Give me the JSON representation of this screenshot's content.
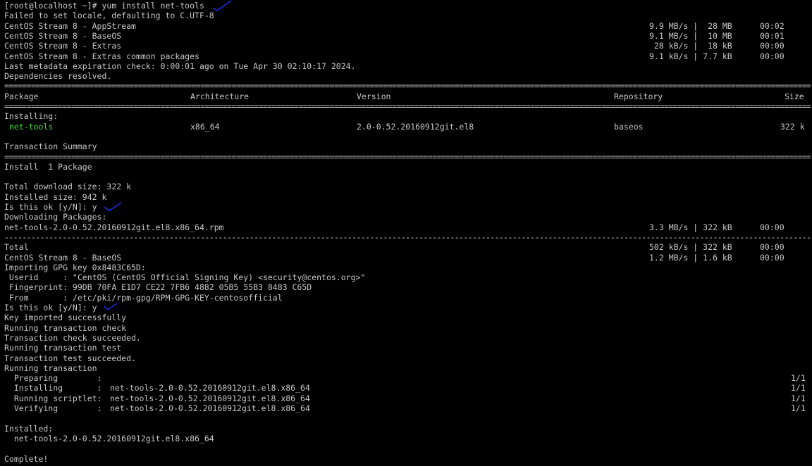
{
  "lines": {
    "prompt": "[root@localhost ~]# yum install net-tools",
    "locale": "Failed to set locale, defaulting to C.UTF-8",
    "last_meta": "Last metadata expiration check: 0:00:01 ago on Tue Apr 30 02:10:17 2024.",
    "deps": "Dependencies resolved.",
    "installing": "Installing:",
    "tx_summary": "Transaction Summary",
    "install_count": "Install  1 Package",
    "dl_size": "Total download size: 322 k",
    "inst_size": "Installed size: 942 k",
    "ok1": "Is this ok [y/N]: y",
    "downloading": "Downloading Packages:",
    "importing": "Importing GPG key 0x8483C65D:",
    "userid": " Userid     : \"CentOS (CentOS Official Signing Key) <security@centos.org>\"",
    "fingerprint": " Fingerprint: 99DB 70FA E1D7 CE22 7FB6 4882 05B5 55B3 8483 C65D",
    "from": " From       : /etc/pki/rpm-gpg/RPM-GPG-KEY-centosofficial",
    "ok2": "Is this ok [y/N]: y",
    "key_ok": "Key imported successfully",
    "run_check": "Running transaction check",
    "check_ok": "Transaction check succeeded.",
    "run_test": "Running transaction test",
    "test_ok": "Transaction test succeeded.",
    "run_tx": "Running transaction",
    "installed_hdr": "Installed:",
    "installed_pkg": "  net-tools-2.0-0.52.20160912git.el8.x86_64",
    "complete": "Complete!"
  },
  "repos": [
    {
      "name": "CentOS Stream 8 - AppStream",
      "rate": "9.9 MB/s |  28 MB",
      "time": "00:02"
    },
    {
      "name": "CentOS Stream 8 - BaseOS",
      "rate": "9.1 MB/s |  10 MB",
      "time": "00:01"
    },
    {
      "name": "CentOS Stream 8 - Extras",
      "rate": " 28 kB/s |  18 kB",
      "time": "00:00"
    },
    {
      "name": "CentOS Stream 8 - Extras common packages",
      "rate": "9.1 kB/s | 7.7 kB",
      "time": "00:00"
    }
  ],
  "table": {
    "headers": [
      "Package",
      "Architecture",
      "Version",
      "Repository",
      "Size"
    ],
    "row": {
      "package": "net-tools",
      "arch": "x86_64",
      "version": "2.0-0.52.20160912git.el8",
      "repo": "baseos",
      "size": "322 k"
    }
  },
  "downloads": [
    {
      "name": "net-tools-2.0-0.52.20160912git.el8.x86_64.rpm",
      "rate": "3.3 MB/s | 322 kB",
      "time": "00:00"
    },
    {
      "name": "Total",
      "rate": "502 kB/s | 322 kB",
      "time": "00:00"
    },
    {
      "name": "CentOS Stream 8 - BaseOS",
      "rate": "1.2 MB/s | 1.6 kB",
      "time": "00:00"
    }
  ],
  "steps": [
    {
      "label": "  Preparing        :",
      "pkg": "",
      "count": "1/1"
    },
    {
      "label": "  Installing       :",
      "pkg": "net-tools-2.0-0.52.20160912git.el8.x86_64",
      "count": "1/1"
    },
    {
      "label": "  Running scriptlet:",
      "pkg": "net-tools-2.0-0.52.20160912git.el8.x86_64",
      "count": "1/1"
    },
    {
      "label": "  Verifying        :",
      "pkg": "net-tools-2.0-0.52.20160912git.el8.x86_64",
      "count": "1/1"
    }
  ],
  "colors": {
    "background": "#000000",
    "text": "#c8c8c8",
    "highlight": "#3ce03c",
    "annotation": "#1a2fe0"
  }
}
